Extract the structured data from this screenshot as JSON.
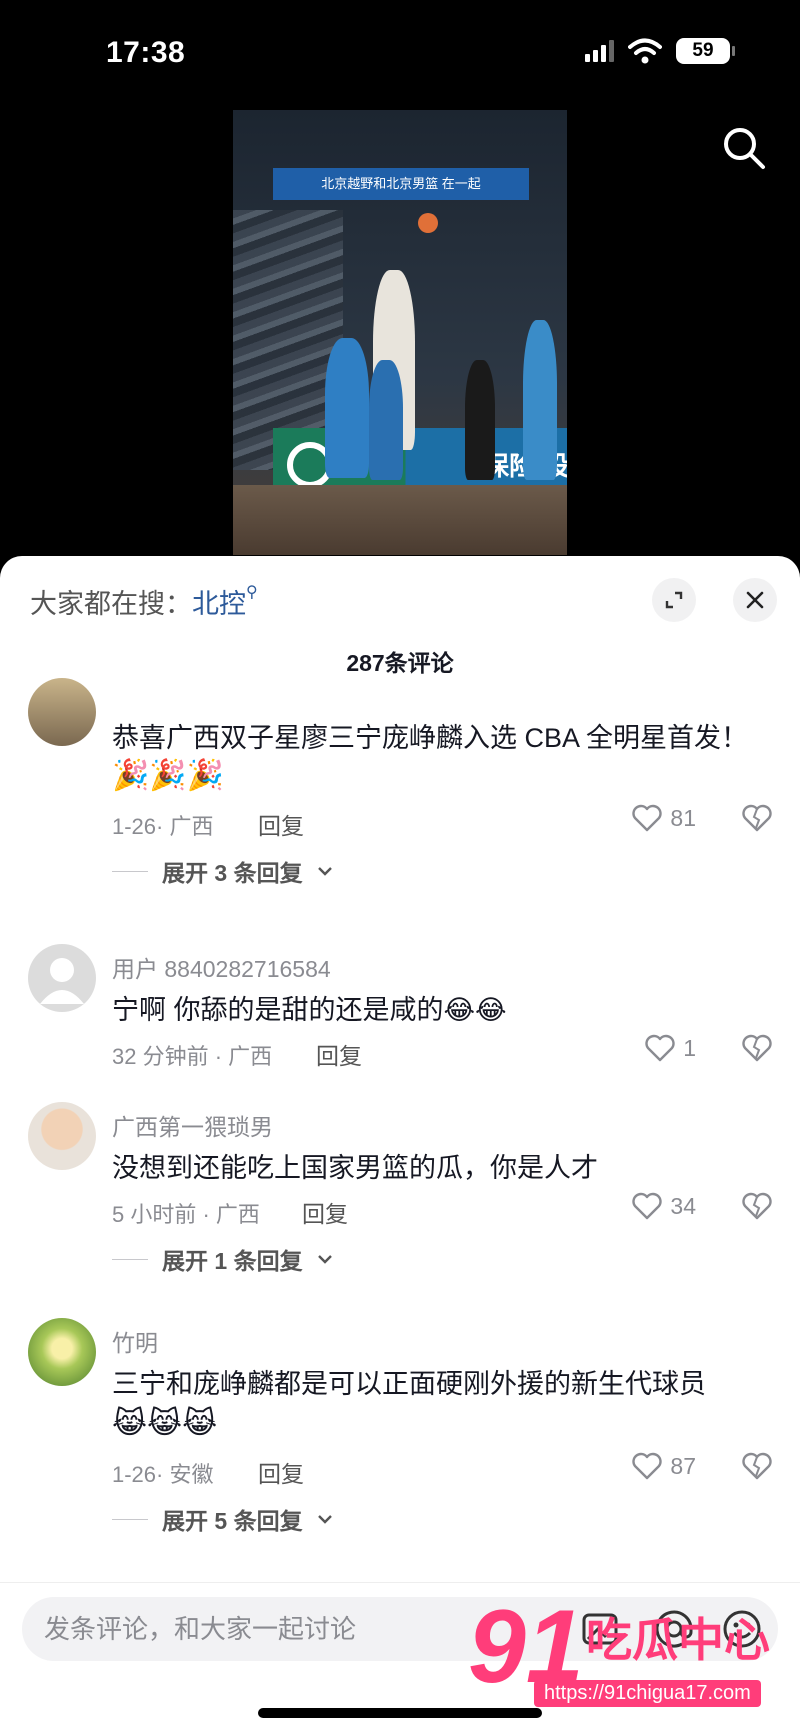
{
  "status_bar": {
    "time": "17:38",
    "battery": "59"
  },
  "video": {
    "banner_text": "北京越野和北京男篮 在一起",
    "board_text": "保险·投"
  },
  "sheet": {
    "hot_search_label": "大家都在搜：",
    "hot_search_keyword": "北控",
    "comment_count_title": "287条评论"
  },
  "comments": [
    {
      "username": "",
      "text": "恭喜广西双子星廖三宁庞峥麟入选 CBA 全明星首发！",
      "emojis": "🎉🎉🎉",
      "time_location": "1-26· 广西",
      "reply_label": "回复",
      "likes": "81",
      "expand_label": "展开 3 条回复"
    },
    {
      "username": "用户 8840282716584",
      "text": "宁啊 你舔的是甜的还是咸的😂😂",
      "time_location": "32 分钟前 · 广西",
      "reply_label": "回复",
      "likes": "1"
    },
    {
      "username": "广西第一猥琐男",
      "text": "没想到还能吃上国家男篮的瓜，你是人才",
      "time_location": "5 小时前 · 广西",
      "reply_label": "回复",
      "likes": "34",
      "expand_label": "展开 1 条回复"
    },
    {
      "username": "竹明",
      "text": "三宁和庞峥麟都是可以正面硬刚外援的新生代球员",
      "emojis": "😹😹😹",
      "time_location": "1-26· 安徽",
      "reply_label": "回复",
      "likes": "87",
      "expand_label": "展开 5 条回复"
    }
  ],
  "input": {
    "placeholder": "发条评论，和大家一起讨论"
  },
  "watermark": {
    "number": "91",
    "name": "吃瓜中心",
    "url": "https://91chigua17.com"
  },
  "icons": [
    "search-icon",
    "expand-icon",
    "close-icon",
    "heart-icon",
    "broken-heart-icon",
    "image-icon",
    "at-icon",
    "emoji-icon",
    "chevron-down-icon"
  ]
}
